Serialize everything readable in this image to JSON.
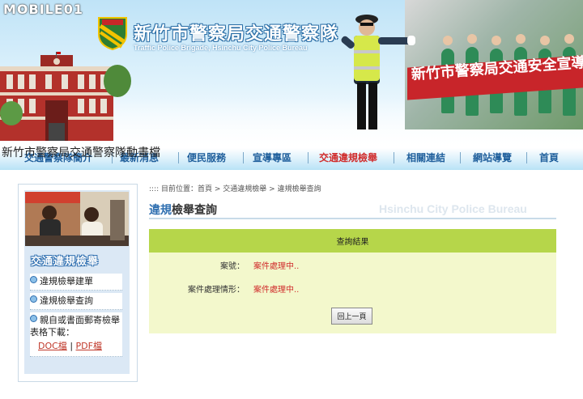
{
  "watermark": "MOBILE01",
  "header": {
    "title_zh": "新竹市警察局交通警察隊",
    "title_en": "Traffic Police Brigade, Hsinchu City Police Bureau",
    "badge_text": "邪警通交",
    "banner_slogan": "新竹市警察局交通安全宣導",
    "flash_alt_text": "新竹市警察局交通警察隊動畫檔"
  },
  "nav": {
    "items": [
      {
        "label": "交通警察隊簡介",
        "active": false
      },
      {
        "label": "最新消息",
        "active": false
      },
      {
        "label": "便民服務",
        "active": false
      },
      {
        "label": "宣導專區",
        "active": false
      },
      {
        "label": "交通違規檢舉",
        "active": true
      },
      {
        "label": "相關連結",
        "active": false
      },
      {
        "label": "網站導覽",
        "active": false
      },
      {
        "label": "首頁",
        "active": false
      }
    ]
  },
  "sidebar": {
    "heading": "交通違規檢舉",
    "items": [
      {
        "label": "違規檢舉建單"
      },
      {
        "label": "違規檢舉查詢"
      },
      {
        "label": "親自或書面郵寄檢舉表格下載："
      }
    ],
    "downloads": {
      "doc": "DOC檔",
      "separator": "|",
      "pdf": "PDF檔"
    }
  },
  "breadcrumb": {
    "prefix": ":::: 目前位置：",
    "items": [
      "首頁",
      "交通違規檢舉",
      "違規檢舉查詢"
    ],
    "separator": " > "
  },
  "main": {
    "title_highlight": "違規",
    "title_rest": "檢舉查詢",
    "bureau_watermark": "Hsinchu City Police Bureau",
    "result_header": "查詢結果",
    "rows": [
      {
        "label": "案號：",
        "value": "案件處理中.."
      },
      {
        "label": "案件處理情形：",
        "value": "案件處理中.."
      }
    ],
    "back_button": "回上一頁"
  },
  "colors": {
    "accent": "#2f6fb0",
    "active_nav": "#d02b2b",
    "result_header_bg": "#b6d64a",
    "result_box_bg": "#f3f8cc",
    "status_red": "#d02b2b"
  }
}
